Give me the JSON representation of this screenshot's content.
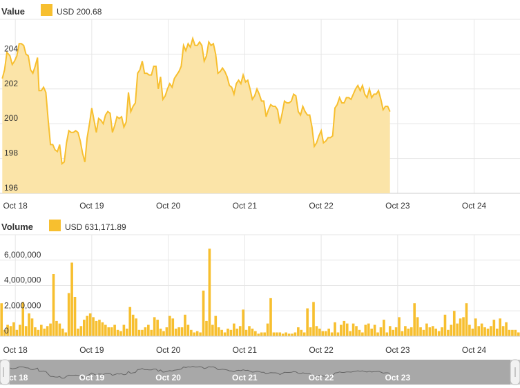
{
  "colors": {
    "accent": "#f7bf2f",
    "area_fill": "#fbe4a8",
    "grid": "#e6e6e6",
    "navigator_bg": "#a8a8a8"
  },
  "header": {
    "value_title": "Value",
    "value_legend": "USD 200.68",
    "volume_title": "Volume",
    "volume_legend": "USD 631,171.89"
  },
  "chart_data": [
    {
      "type": "area",
      "title": "Value",
      "series": [
        {
          "name": "USD",
          "color": "#f7bf2f"
        }
      ],
      "x_unit": "days",
      "x_tick_labels": [
        "Oct 18",
        "Oct 19",
        "Oct 20",
        "Oct 21",
        "Oct 22",
        "Oct 23",
        "Oct 24"
      ],
      "xlim": [
        17.3,
        24.1
      ],
      "ylim": [
        196,
        206
      ],
      "y_ticks": [
        196,
        198,
        200,
        202,
        204
      ],
      "grid": true,
      "points": [
        [
          17.33,
          202.6
        ],
        [
          17.36,
          203.1
        ],
        [
          17.39,
          204.1
        ],
        [
          17.43,
          203.9
        ],
        [
          17.46,
          203.4
        ],
        [
          17.49,
          203.6
        ],
        [
          17.52,
          203.9
        ],
        [
          17.55,
          204.6
        ],
        [
          17.58,
          204.6
        ],
        [
          17.61,
          204.5
        ],
        [
          17.64,
          204.0
        ],
        [
          17.67,
          203.9
        ],
        [
          17.7,
          203.1
        ],
        [
          17.73,
          202.9
        ],
        [
          17.76,
          203.3
        ],
        [
          17.79,
          203.8
        ],
        [
          17.81,
          201.9
        ],
        [
          17.84,
          201.9
        ],
        [
          17.87,
          202.1
        ],
        [
          17.9,
          201.8
        ],
        [
          17.93,
          200.2
        ],
        [
          17.96,
          198.8
        ],
        [
          17.99,
          198.8
        ],
        [
          18.02,
          198.5
        ],
        [
          18.05,
          198.4
        ],
        [
          18.08,
          198.8
        ],
        [
          18.11,
          197.7
        ],
        [
          18.14,
          197.8
        ],
        [
          18.17,
          198.9
        ],
        [
          18.2,
          199.6
        ],
        [
          18.23,
          199.5
        ],
        [
          18.26,
          199.5
        ],
        [
          18.29,
          199.6
        ],
        [
          18.32,
          199.5
        ],
        [
          18.35,
          199.0
        ],
        [
          18.38,
          198.3
        ],
        [
          18.41,
          197.8
        ],
        [
          18.44,
          199.2
        ],
        [
          18.47,
          200.0
        ],
        [
          18.5,
          200.9
        ],
        [
          18.53,
          200.2
        ],
        [
          18.56,
          199.5
        ],
        [
          18.59,
          200.3
        ],
        [
          18.62,
          200.2
        ],
        [
          18.65,
          200.0
        ],
        [
          18.68,
          200.5
        ],
        [
          18.71,
          200.7
        ],
        [
          18.74,
          200.6
        ],
        [
          18.77,
          199.5
        ],
        [
          18.8,
          199.9
        ],
        [
          18.83,
          200.4
        ],
        [
          18.86,
          200.3
        ],
        [
          18.89,
          200.4
        ],
        [
          18.92,
          199.8
        ],
        [
          18.95,
          200.1
        ],
        [
          18.98,
          201.8
        ],
        [
          19.01,
          200.7
        ],
        [
          19.04,
          201.0
        ],
        [
          19.07,
          201.2
        ],
        [
          19.1,
          202.9
        ],
        [
          19.13,
          203.1
        ],
        [
          19.16,
          203.6
        ],
        [
          19.19,
          202.9
        ],
        [
          19.22,
          202.9
        ],
        [
          19.25,
          202.8
        ],
        [
          19.28,
          202.8
        ],
        [
          19.31,
          203.3
        ],
        [
          19.34,
          203.3
        ],
        [
          19.37,
          202.0
        ],
        [
          19.4,
          202.7
        ],
        [
          19.43,
          201.4
        ],
        [
          19.46,
          201.6
        ],
        [
          19.49,
          202.0
        ],
        [
          19.52,
          202.3
        ],
        [
          19.55,
          202.1
        ],
        [
          19.58,
          202.6
        ],
        [
          19.61,
          202.8
        ],
        [
          19.64,
          203.0
        ],
        [
          19.67,
          203.3
        ],
        [
          19.7,
          204.5
        ],
        [
          19.73,
          204.2
        ],
        [
          19.76,
          204.6
        ],
        [
          19.79,
          204.4
        ],
        [
          19.82,
          204.9
        ],
        [
          19.85,
          204.5
        ],
        [
          19.88,
          204.5
        ],
        [
          19.91,
          204.7
        ],
        [
          19.94,
          204.5
        ],
        [
          19.97,
          203.6
        ],
        [
          20.0,
          203.9
        ],
        [
          20.03,
          204.7
        ],
        [
          20.06,
          204.5
        ],
        [
          20.09,
          204.6
        ],
        [
          20.12,
          204.0
        ],
        [
          20.15,
          202.9
        ],
        [
          20.18,
          203.0
        ],
        [
          20.21,
          203.2
        ],
        [
          20.24,
          203.0
        ],
        [
          20.27,
          202.7
        ],
        [
          20.3,
          202.2
        ],
        [
          20.33,
          202.1
        ],
        [
          20.36,
          201.7
        ],
        [
          20.39,
          202.3
        ],
        [
          20.42,
          202.5
        ],
        [
          20.45,
          202.3
        ],
        [
          20.48,
          202.8
        ],
        [
          20.51,
          202.4
        ],
        [
          20.54,
          202.5
        ],
        [
          20.57,
          202.0
        ],
        [
          20.6,
          201.4
        ],
        [
          20.63,
          201.6
        ],
        [
          20.66,
          202.0
        ],
        [
          20.69,
          201.7
        ],
        [
          20.72,
          201.3
        ],
        [
          20.75,
          201.3
        ],
        [
          20.78,
          200.4
        ],
        [
          20.81,
          200.8
        ],
        [
          20.84,
          201.1
        ],
        [
          20.87,
          201.0
        ],
        [
          20.9,
          201.0
        ],
        [
          20.93,
          200.8
        ],
        [
          20.96,
          200.0
        ],
        [
          20.99,
          200.6
        ],
        [
          21.02,
          201.3
        ],
        [
          21.05,
          201.2
        ],
        [
          21.08,
          201.2
        ],
        [
          21.11,
          201.3
        ],
        [
          21.14,
          201.7
        ],
        [
          21.17,
          201.6
        ],
        [
          21.2,
          200.7
        ],
        [
          21.23,
          200.5
        ],
        [
          21.26,
          201.0
        ],
        [
          21.29,
          200.7
        ],
        [
          21.32,
          200.5
        ],
        [
          21.35,
          200.5
        ],
        [
          21.38,
          199.8
        ],
        [
          21.41,
          198.7
        ],
        [
          21.44,
          198.9
        ],
        [
          21.47,
          199.3
        ],
        [
          21.5,
          199.6
        ],
        [
          21.53,
          198.9
        ],
        [
          21.56,
          199.0
        ],
        [
          21.59,
          199.2
        ],
        [
          21.62,
          199.2
        ],
        [
          21.65,
          199.3
        ],
        [
          21.68,
          200.9
        ],
        [
          21.71,
          201.1
        ],
        [
          21.74,
          201.5
        ],
        [
          21.77,
          201.2
        ],
        [
          21.8,
          201.2
        ],
        [
          21.83,
          201.5
        ],
        [
          21.86,
          201.5
        ],
        [
          21.89,
          201.4
        ],
        [
          21.92,
          201.7
        ],
        [
          21.95,
          202.0
        ],
        [
          21.98,
          202.2
        ],
        [
          22.01,
          201.9
        ],
        [
          22.04,
          202.2
        ],
        [
          22.07,
          201.7
        ],
        [
          22.1,
          201.5
        ],
        [
          22.13,
          202.0
        ],
        [
          22.16,
          201.5
        ],
        [
          22.19,
          201.7
        ],
        [
          22.22,
          201.7
        ],
        [
          22.25,
          201.9
        ],
        [
          22.28,
          201.4
        ],
        [
          22.31,
          200.8
        ],
        [
          22.34,
          201.0
        ],
        [
          22.37,
          201.0
        ],
        [
          22.4,
          200.7
        ]
      ]
    },
    {
      "type": "bar",
      "title": "Volume",
      "series": [
        {
          "name": "USD",
          "color": "#f7bf2f"
        }
      ],
      "x_unit": "days",
      "x_tick_labels": [
        "Oct 18",
        "Oct 19",
        "Oct 20",
        "Oct 21",
        "Oct 22",
        "Oct 23",
        "Oct 24"
      ],
      "xlim": [
        17.3,
        24.1
      ],
      "ylim": [
        0,
        8000000
      ],
      "y_tick_labels": [
        "0",
        "2,000,000",
        "4,000,000",
        "6,000,000"
      ],
      "grid": true,
      "values": [
        2600000,
        500000,
        900000,
        800000,
        1100000,
        500000,
        900000,
        2700000,
        800000,
        1800000,
        1400000,
        700000,
        500000,
        900000,
        600000,
        800000,
        1000000,
        4900000,
        1200000,
        1000000,
        600000,
        300000,
        3400000,
        5800000,
        3100000,
        600000,
        800000,
        1300000,
        1600000,
        1800000,
        1500000,
        1200000,
        1300000,
        1100000,
        900000,
        700000,
        700000,
        900000,
        500000,
        400000,
        900000,
        600000,
        2300000,
        1700000,
        1400000,
        500000,
        500000,
        700000,
        900000,
        500000,
        1500000,
        1300000,
        600000,
        400000,
        700000,
        1600000,
        1400000,
        600000,
        700000,
        700000,
        1700000,
        900000,
        500000,
        300000,
        400000,
        300000,
        3600000,
        1200000,
        6900000,
        900000,
        1600000,
        700000,
        500000,
        300000,
        600000,
        500000,
        1000000,
        600000,
        800000,
        2100000,
        500000,
        800000,
        600000,
        400000,
        200000,
        300000,
        300000,
        1000000,
        3000000,
        300000,
        300000,
        300000,
        200000,
        300000,
        200000,
        200000,
        300000,
        700000,
        500000,
        300000,
        2200000,
        700000,
        2700000,
        800000,
        600000,
        400000,
        400000,
        600000,
        300000,
        1100000,
        300000,
        900000,
        1200000,
        1000000,
        400000,
        1000000,
        800000,
        500000,
        300000,
        900000,
        1000000,
        600000,
        900000,
        300000,
        700000,
        1300000,
        300000,
        800000,
        500000,
        700000,
        1500000,
        400000,
        800000,
        600000,
        700000,
        2600000,
        1500000,
        700000,
        500000,
        1000000,
        700000,
        800000,
        600000,
        400000,
        700000,
        1700000,
        500000,
        900000,
        2000000,
        1000000,
        1400000,
        1500000,
        2600000,
        900000,
        600000,
        1400000,
        800000,
        1000000,
        700000,
        600000,
        800000,
        1300000,
        600000,
        1400000,
        800000,
        1100000,
        500000,
        500000,
        500000,
        300000
      ]
    }
  ]
}
